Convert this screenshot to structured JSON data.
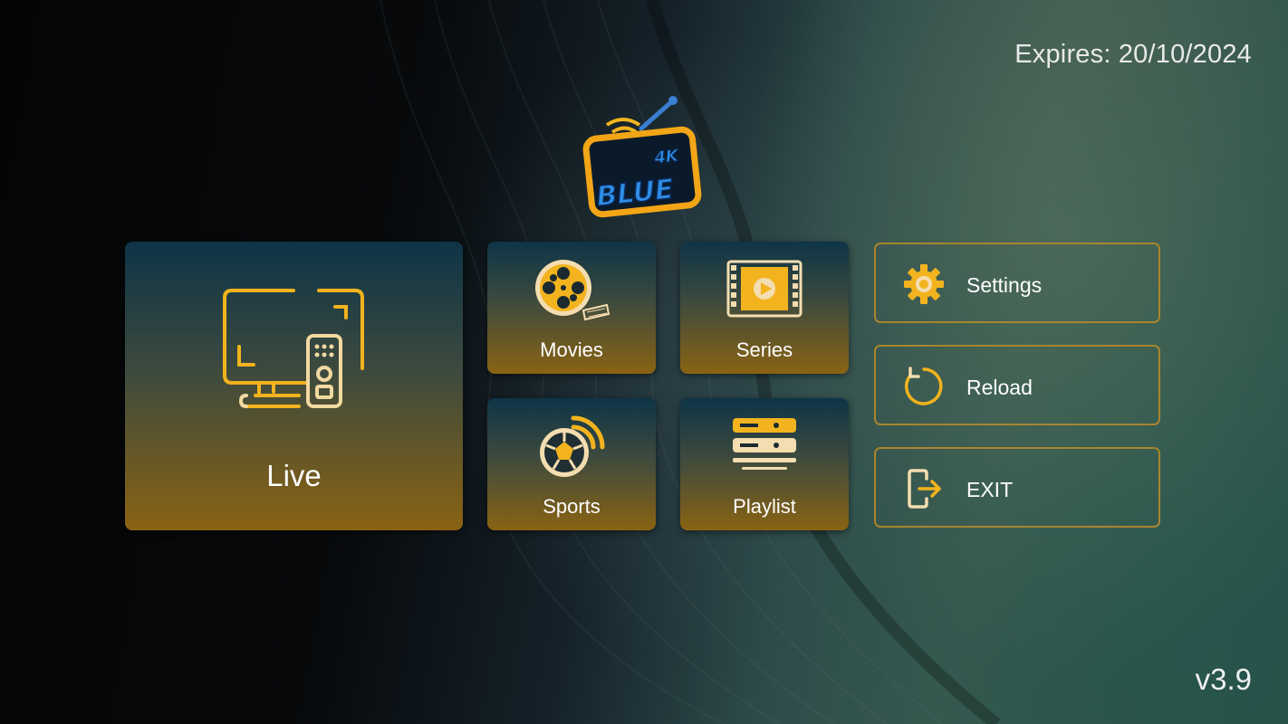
{
  "header": {
    "expires_text": "Expires: 20/10/2024"
  },
  "logo": {
    "brand_text": "BLUE",
    "badge_text": "4K"
  },
  "tiles": {
    "live": {
      "label": "Live",
      "icon": "tv-remote-icon"
    },
    "movies": {
      "label": "Movies",
      "icon": "film-reel-icon"
    },
    "series": {
      "label": "Series",
      "icon": "film-strip-play-icon"
    },
    "sports": {
      "label": "Sports",
      "icon": "soccer-ball-signal-icon"
    },
    "playlist": {
      "label": "Playlist",
      "icon": "server-stack-icon"
    }
  },
  "actions": {
    "settings": {
      "label": "Settings",
      "icon": "gear-icon"
    },
    "reload": {
      "label": "Reload",
      "icon": "reload-icon"
    },
    "exit": {
      "label": "EXIT",
      "icon": "exit-door-icon"
    }
  },
  "footer": {
    "version": "v3.9"
  },
  "colors": {
    "accent_gold": "#f2b31e",
    "border_gold": "#a8852e",
    "tile_top": "#0e3447",
    "tile_bottom": "#8a6312"
  }
}
